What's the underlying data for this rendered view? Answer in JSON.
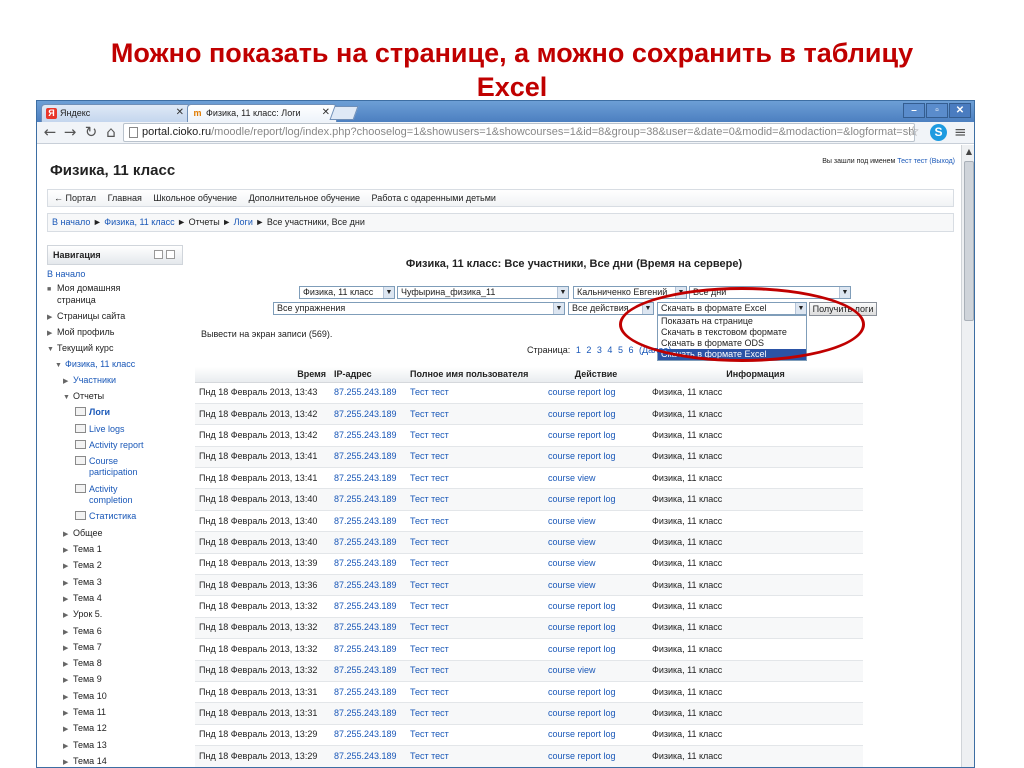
{
  "slide": {
    "title_line1": "Можно показать на странице, а можно сохранить в таблицу",
    "title_line2": "Excel"
  },
  "browser": {
    "tabs": [
      {
        "label": "Яндекс",
        "favicon": "yandex-icon"
      },
      {
        "label": "Физика, 11 класс: Логи",
        "favicon": "moodle-icon"
      }
    ],
    "url_host": "portal.cioko.ru",
    "url_path": "/moodle/report/log/index.php?chooselog=1&showusers=1&showcourses=1&id=8&group=38&user=&date=0&modid=&modaction=&logformat=showash",
    "icons": [
      "back-icon",
      "forward-icon",
      "reload-icon",
      "home-icon",
      "star-icon",
      "skype-icon",
      "menu-icon"
    ]
  },
  "page": {
    "course_title": "Физика, 11 класс",
    "login_text": "Вы зашли под именем",
    "login_user": "Тест тест",
    "login_logout": "(Выход)",
    "navbar": [
      "← Портал",
      "Главная",
      "Школьное обучение",
      "Дополнительное обучение",
      "Работа с одаренными детьми"
    ],
    "breadcrumb": {
      "home": "В начало",
      "sep": "►",
      "course": "Физика, 11 класс",
      "reports": "Отчеты",
      "logs": "Логи",
      "current": "Все участники, Все дни"
    }
  },
  "navigation": {
    "title": "Навигация",
    "home": "В начало",
    "items": [
      {
        "label": "Моя домашняя",
        "label2": "страница",
        "marker": "■"
      },
      {
        "label": "Страницы сайта",
        "marker": "▶"
      },
      {
        "label": "Мой профиль",
        "marker": "▶"
      },
      {
        "label": "Текущий курс",
        "marker": "▼"
      },
      {
        "label": "Физика, 11 класс",
        "marker": "▼"
      },
      {
        "label": "Участники",
        "marker": "▶"
      },
      {
        "label": "Отчеты",
        "marker": "▼"
      },
      {
        "label": "Логи"
      },
      {
        "label": "Live logs"
      },
      {
        "label": "Activity report"
      },
      {
        "label": "Course",
        "label2": "participation"
      },
      {
        "label": "Activity",
        "label2": "completion"
      },
      {
        "label": "Статистика"
      },
      {
        "label": "Общее",
        "marker": "▶"
      },
      {
        "label": "Тема 1",
        "marker": "▶"
      },
      {
        "label": "Тема 2",
        "marker": "▶"
      },
      {
        "label": "Тема 3",
        "marker": "▶"
      },
      {
        "label": "Тема 4",
        "marker": "▶"
      },
      {
        "label": "Урок 5.",
        "marker": "▶"
      },
      {
        "label": "Тема 6",
        "marker": "▶"
      },
      {
        "label": "Тема 7",
        "marker": "▶"
      },
      {
        "label": "Тема 8",
        "marker": "▶"
      },
      {
        "label": "Тема 9",
        "marker": "▶"
      },
      {
        "label": "Тема 10",
        "marker": "▶"
      },
      {
        "label": "Тема 11",
        "marker": "▶"
      },
      {
        "label": "Тема 12",
        "marker": "▶"
      },
      {
        "label": "Тема 13",
        "marker": "▶"
      },
      {
        "label": "Тема 14",
        "marker": "▶"
      }
    ]
  },
  "report": {
    "title": "Физика, 11 класс: Все участники, Все дни (Время на сервере)",
    "filters": {
      "course": "Физика, 11 класс",
      "group": "Чуфырина_физика_11",
      "user": "Кальниченко Евгений",
      "date": "Все дни",
      "activity": "Все упражнения",
      "action": "Все действия",
      "format": "Скачать в формате Excel",
      "get_logs": "Получить логи"
    },
    "format_options": [
      "Показать на странице",
      "Скачать в текстовом формате",
      "Скачать в формате ODS",
      "Скачать в формате Excel"
    ],
    "records_text": "Вывести на экран записи (569).",
    "pager_label": "Страница:",
    "pages": [
      "1",
      "2",
      "3",
      "4",
      "5",
      "6",
      "(Далее)"
    ],
    "columns": [
      "Время",
      "IP-адрес",
      "Полное имя пользователя",
      "Действие",
      "Информация"
    ],
    "rows": [
      [
        "Пнд 18 Февраль 2013, 13:43",
        "87.255.243.189",
        "Тест тест",
        "course report log",
        "Физика, 11 класс"
      ],
      [
        "Пнд 18 Февраль 2013, 13:42",
        "87.255.243.189",
        "Тест тест",
        "course report log",
        "Физика, 11 класс"
      ],
      [
        "Пнд 18 Февраль 2013, 13:42",
        "87.255.243.189",
        "Тест тест",
        "course report log",
        "Физика, 11 класс"
      ],
      [
        "Пнд 18 Февраль 2013, 13:41",
        "87.255.243.189",
        "Тест тест",
        "course report log",
        "Физика, 11 класс"
      ],
      [
        "Пнд 18 Февраль 2013, 13:41",
        "87.255.243.189",
        "Тест тест",
        "course view",
        "Физика, 11 класс"
      ],
      [
        "Пнд 18 Февраль 2013, 13:40",
        "87.255.243.189",
        "Тест тест",
        "course report log",
        "Физика, 11 класс"
      ],
      [
        "Пнд 18 Февраль 2013, 13:40",
        "87.255.243.189",
        "Тест тест",
        "course view",
        "Физика, 11 класс"
      ],
      [
        "Пнд 18 Февраль 2013, 13:40",
        "87.255.243.189",
        "Тест тест",
        "course view",
        "Физика, 11 класс"
      ],
      [
        "Пнд 18 Февраль 2013, 13:39",
        "87.255.243.189",
        "Тест тест",
        "course view",
        "Физика, 11 класс"
      ],
      [
        "Пнд 18 Февраль 2013, 13:36",
        "87.255.243.189",
        "Тест тест",
        "course view",
        "Физика, 11 класс"
      ],
      [
        "Пнд 18 Февраль 2013, 13:32",
        "87.255.243.189",
        "Тест тест",
        "course report log",
        "Физика, 11 класс"
      ],
      [
        "Пнд 18 Февраль 2013, 13:32",
        "87.255.243.189",
        "Тест тест",
        "course report log",
        "Физика, 11 класс"
      ],
      [
        "Пнд 18 Февраль 2013, 13:32",
        "87.255.243.189",
        "Тест тест",
        "course report log",
        "Физика, 11 класс"
      ],
      [
        "Пнд 18 Февраль 2013, 13:32",
        "87.255.243.189",
        "Тест тест",
        "course view",
        "Физика, 11 класс"
      ],
      [
        "Пнд 18 Февраль 2013, 13:31",
        "87.255.243.189",
        "Тест тест",
        "course report log",
        "Физика, 11 класс"
      ],
      [
        "Пнд 18 Февраль 2013, 13:31",
        "87.255.243.189",
        "Тест тест",
        "course report log",
        "Физика, 11 класс"
      ],
      [
        "Пнд 18 Февраль 2013, 13:29",
        "87.255.243.189",
        "Тест тест",
        "course report log",
        "Физика, 11 класс"
      ],
      [
        "Пнд 18 Февраль 2013, 13:29",
        "87.255.243.189",
        "Тест тест",
        "course report log",
        "Физика, 11 класс"
      ]
    ]
  },
  "colors": {
    "slide_title": "#c00000",
    "link": "#1a58b8",
    "highlight_ellipse": "#c00000",
    "selected_option": "#2b53a6"
  }
}
